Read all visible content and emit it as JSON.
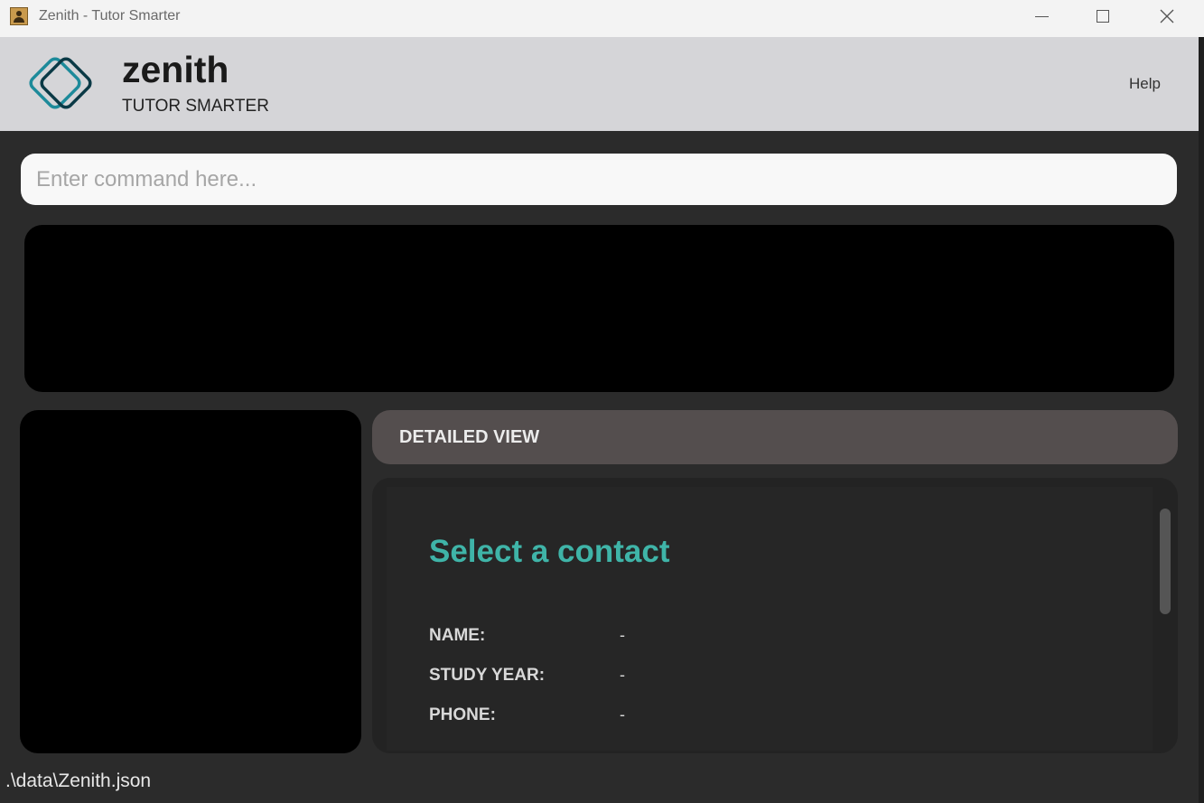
{
  "window": {
    "title": "Zenith - Tutor Smarter"
  },
  "header": {
    "brand_name": "zenith",
    "tagline": "TUTOR SMARTER",
    "help_label": "Help",
    "logo_colors": [
      "#1d8a9a",
      "#0b3a46",
      "#111111"
    ]
  },
  "command": {
    "placeholder": "Enter command here...",
    "value": ""
  },
  "detail": {
    "header_label": "DETAILED VIEW",
    "title": "Select a contact",
    "fields": [
      {
        "label": "NAME:",
        "value": "-"
      },
      {
        "label": "STUDY YEAR:",
        "value": "-"
      },
      {
        "label": "PHONE:",
        "value": "-"
      }
    ]
  },
  "status": {
    "path": ".\\data\\Zenith.json"
  },
  "colors": {
    "accent": "#3fb4a8",
    "background": "#2b2b2b",
    "header_bg": "#d5d5d8",
    "detail_header_bg": "#544e4e"
  }
}
